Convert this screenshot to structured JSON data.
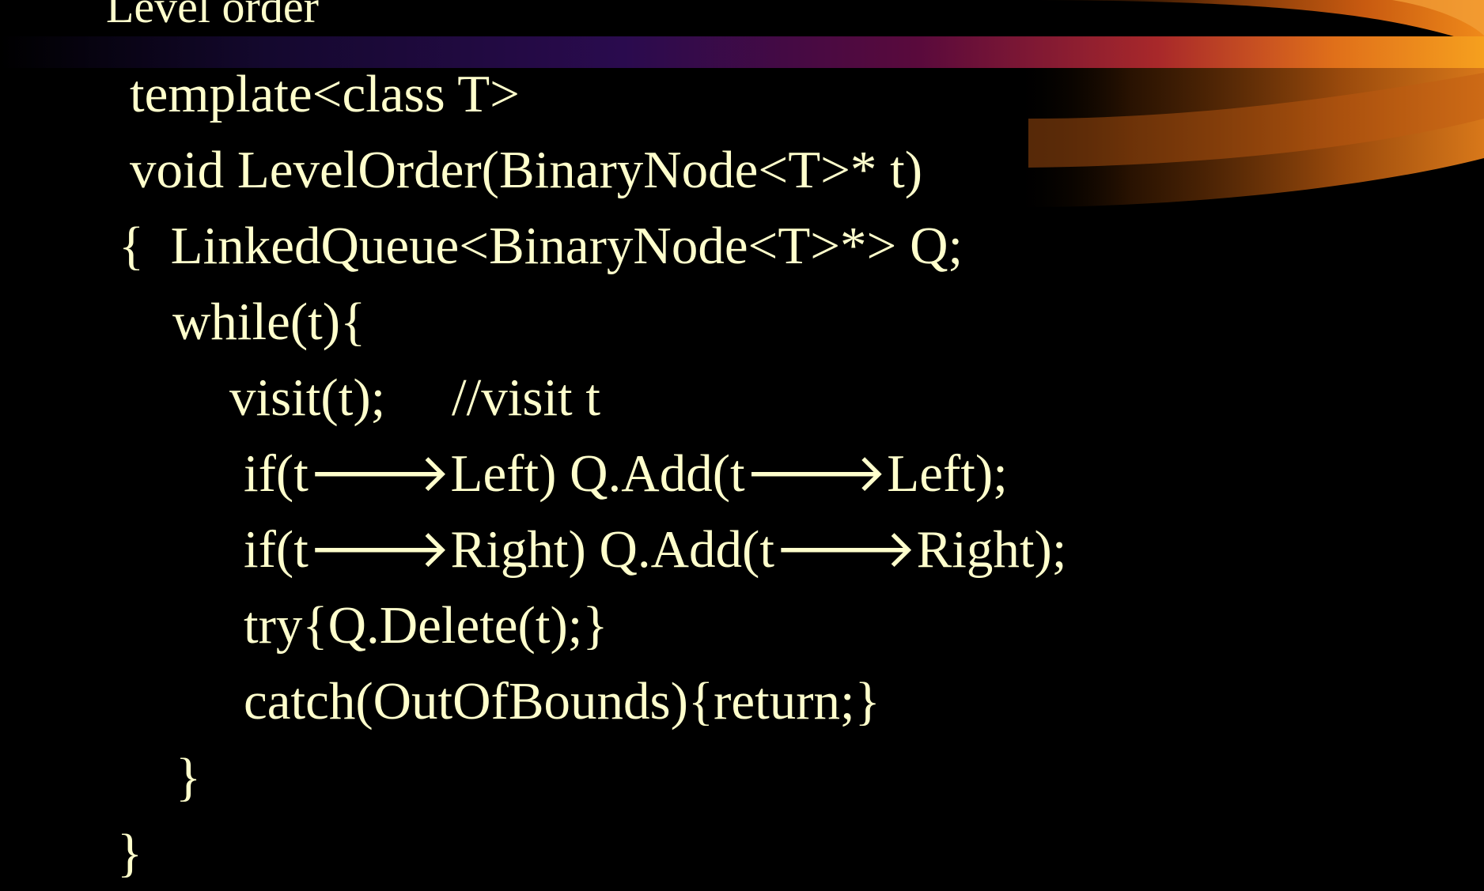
{
  "slide": {
    "title": "Level order",
    "code_lines": [
      "template<class T>",
      "void LevelOrder(BinaryNode<T>* t)",
      "{  LinkedQueue<BinaryNode<T>*> Q;",
      "while(t){",
      "visit(t);     //visit t",
      "if(t🡒Left) Q.Add(t🡒Left);",
      "if(t🡒Right) Q.Add(t🡒Right);",
      "try{Q.Delete(t);}",
      "catch(OutOfBounds){return;}",
      "}",
      "}"
    ]
  },
  "colors": {
    "background": "#000000",
    "text": "#FFFFCC",
    "accent_orange": "#F59A1E",
    "accent_purple": "#2A0B50"
  }
}
